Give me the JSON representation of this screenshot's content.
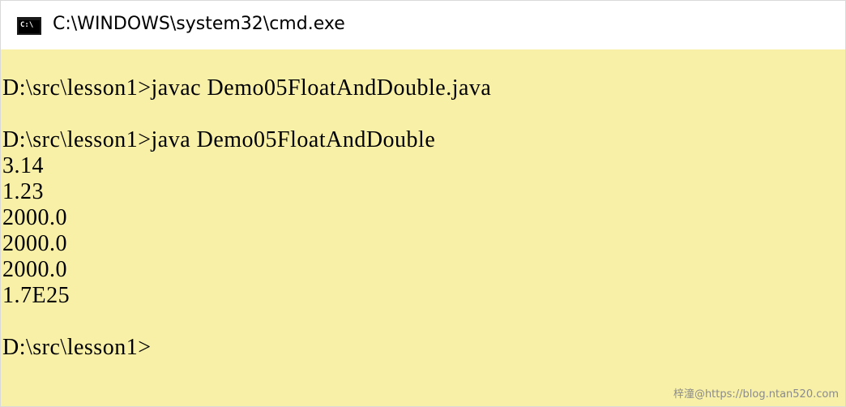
{
  "window": {
    "title": "C:\\WINDOWS\\system32\\cmd.exe",
    "icon": "cmd-icon",
    "icon_prompt": "C:\\"
  },
  "console": {
    "background": "#f8f0a7",
    "text_color": "#000000",
    "lines": [
      "D:\\src\\lesson1>javac Demo05FloatAndDouble.java",
      "",
      "D:\\src\\lesson1>java Demo05FloatAndDouble",
      "3.14",
      "1.23",
      "2000.0",
      "2000.0",
      "2000.0",
      "1.7E25",
      "",
      "D:\\src\\lesson1>"
    ]
  },
  "watermark": "梓潼@https://blog.ntan520.com"
}
